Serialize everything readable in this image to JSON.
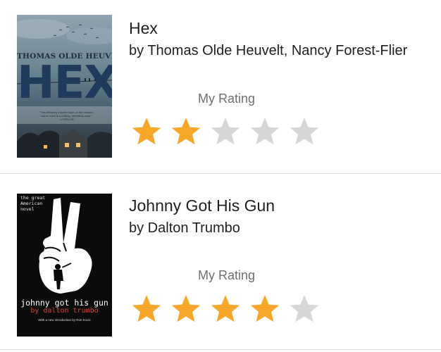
{
  "colors": {
    "star_filled": "#f7a82a",
    "star_empty": "#d6d6d6",
    "divider": "#dcdcdc",
    "text_primary": "#212121",
    "text_secondary": "#6f6f6f"
  },
  "books": [
    {
      "title": "Hex",
      "author": "by Thomas Olde Heuvelt, Nancy Forest-Flier",
      "rating_label": "My Rating",
      "rating": 2,
      "max_rating": 5,
      "cover": {
        "author_text": "THOMAS OLDE HEUVELT",
        "title_text": "HEX",
        "blurb_text": "“This brilliantly inspired take on the modern horror novel is a chilling, relentless read.”",
        "blurb_source": "—FORCOR"
      }
    },
    {
      "title": "Johnny Got His Gun",
      "author": "by Dalton Trumbo",
      "rating_label": "My Rating",
      "rating": 4,
      "max_rating": 5,
      "cover": {
        "top_line_1": "the great",
        "top_line_2": "American",
        "top_line_3": "novel",
        "title_text": "johnny got his gun",
        "author_text": "by dalton trumbo",
        "sub_text": "With a new introduction by Ron Kovic"
      }
    }
  ]
}
